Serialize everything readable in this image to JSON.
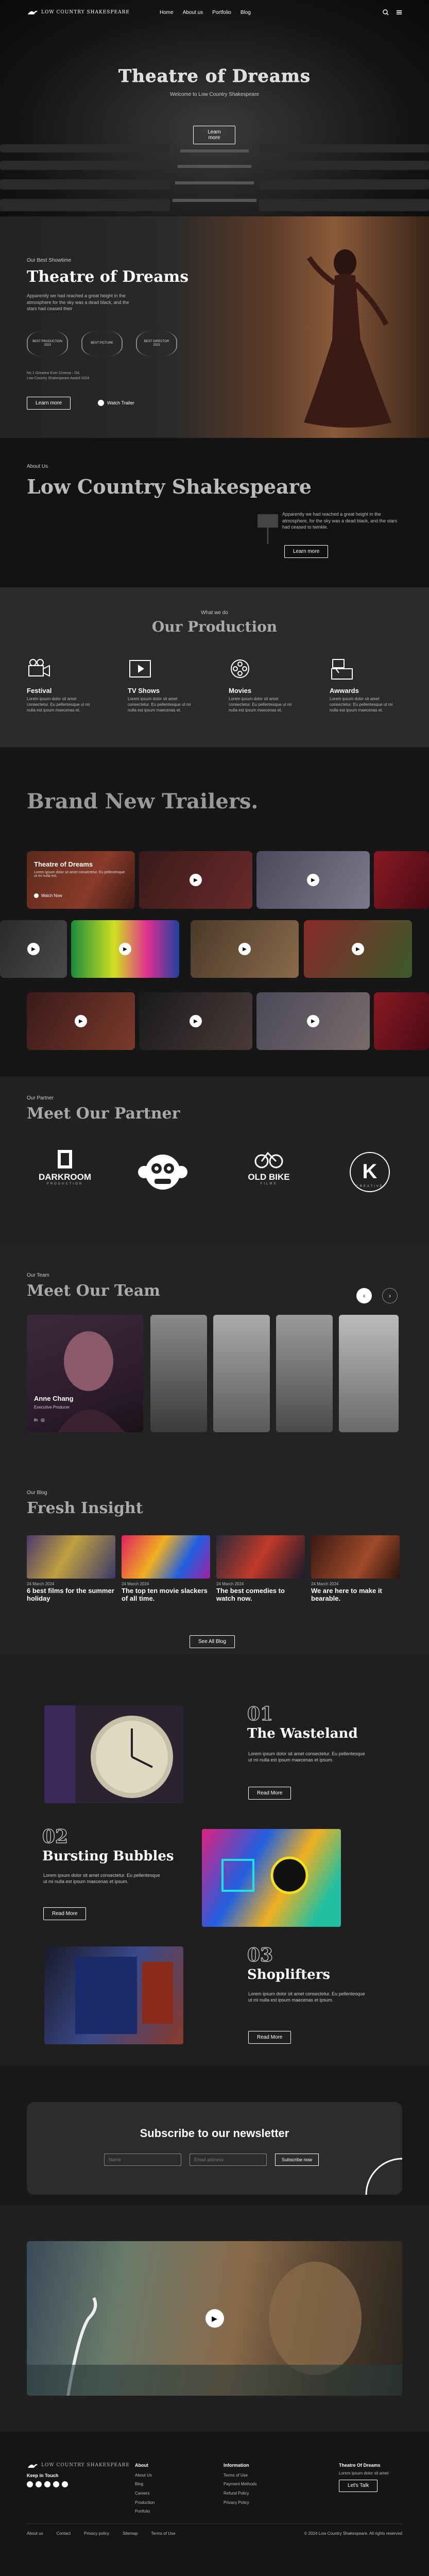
{
  "header": {
    "logo_text": "LOW COUNTRY SHAKESPEARE",
    "nav": [
      "Home",
      "About us",
      "Portfolio",
      "Blog"
    ],
    "icons": [
      "search-icon",
      "menu-icon"
    ]
  },
  "hero": {
    "title": "Theatre of Dreams",
    "subtitle": "Welcome to Low Country Shakespeare",
    "button": "Learn more"
  },
  "showtime": {
    "eyebrow": "Our Best Showtime",
    "title": "Theatre of Dreams",
    "description": "Apparently we had reached a great height in the atmosphere for the sky was a dead black, and the stars had ceased their",
    "badges": [
      "BEST PRODUCTION 2023",
      "BEST PICTURE",
      "BEST DIRECTOR 2023"
    ],
    "note_line1": "No 1 Greatest Ever Cinema - OA",
    "note_line2": "Low Country Shakespeare Award 2024",
    "learn_button": "Learn more",
    "watch_label": "Watch Trailer"
  },
  "about": {
    "eyebrow": "About Us",
    "title": "Low Country Shakespeare",
    "description": "Apparently we had reached a great height in the atmosphere, for the sky was a dead black, and the stars had ceased to twinkle.",
    "button": "Learn more"
  },
  "production": {
    "eyebrow": "What we do",
    "title": "Our Production",
    "items": [
      {
        "name": "Festival",
        "desc": "Lorem ipsum dolor sit amet consectetur. Eu pellentesque ut mi nulla est ipsum maecenas et.",
        "icon": "camera-icon"
      },
      {
        "name": "TV Shows",
        "desc": "Lorem ipsum dolor sit amet consectetur. Eu pellentesque ut mi nulla est ipsum maecenas et.",
        "icon": "film-strip-icon"
      },
      {
        "name": "Movies",
        "desc": "Lorem ipsum dolor sit amet consectetur. Eu pellentesque ut mi nulla est ipsum maecenas et.",
        "icon": "film-reel-icon"
      },
      {
        "name": "Awwards",
        "desc": "Lorem ipsum dolor sit amet consectetur. Eu pellentesque ut mi nulla est ipsum maecenas et.",
        "icon": "clapperboard-icon"
      }
    ]
  },
  "trailers": {
    "title": "Brand New Trailers.",
    "feature_title": "Theatre of Dreams",
    "feature_desc": "Lorem ipsum dolor sit amet consectetur. Eu pellentesque ut mi nulla est.",
    "feature_watch": "Watch Now"
  },
  "partners": {
    "eyebrow": "Our Partner",
    "title": "Meet Our Partner",
    "items": [
      {
        "name": "DARKROOM",
        "sub": "PRODUCTION"
      },
      {
        "name": "",
        "sub": ""
      },
      {
        "name": "OLD BIKE",
        "sub": "FILMS"
      },
      {
        "name": "K",
        "sub": "CREATIVE"
      }
    ]
  },
  "team": {
    "eyebrow": "Our Team",
    "title": "Meet Our Team",
    "featured_name": "Anne Chang",
    "featured_role": "Executive Producer",
    "arrows": [
      "arrow-left-icon",
      "arrow-right-icon"
    ]
  },
  "blog": {
    "eyebrow": "Our Blog",
    "title": "Fresh Insight",
    "posts": [
      {
        "date": "24 March 2024",
        "title": "6 best films for the summer holiday"
      },
      {
        "date": "24 March 2024",
        "title": "The top ten movie slackers of all time."
      },
      {
        "date": "24 March 2024",
        "title": "The best comedies to watch now."
      },
      {
        "date": "24 March 2024",
        "title": "We are here to make it bearable."
      }
    ],
    "see_all": "See All Blog"
  },
  "features": [
    {
      "num": "01",
      "title": "The Wasteland",
      "desc": "Lorem ipsum dolor sit amet consectetur. Eu pellentesque ut mi nulla est ipsum maecenas et ipsum.",
      "button": "Read More"
    },
    {
      "num": "02",
      "title": "Bursting Bubbles",
      "desc": "Lorem ipsum dolor sit amet consectetur. Eu pellentesque ut mi nulla est ipsum maecenas et ipsum.",
      "button": "Read More"
    },
    {
      "num": "03",
      "title": "Shoplifters",
      "desc": "Lorem ipsum dolor sit amet consectetur. Eu pellentesque ut mi nulla est ipsum maecenas et ipsum.",
      "button": "Read More"
    }
  ],
  "newsletter": {
    "title": "Subscribe to our newsletter",
    "name_placeholder": "Name",
    "email_placeholder": "Email address",
    "button": "Subscribe now"
  },
  "footer": {
    "logo_text": "LOW COUNTRY SHAKESPEARE",
    "keep_in_touch": "Keep in Touch",
    "social_icons": [
      "facebook-icon",
      "twitter-icon",
      "x-icon",
      "instagram-icon",
      "pinterest-icon"
    ],
    "about_heading": "About",
    "about_links": [
      "About Us",
      "Blog",
      "Careers",
      "Production",
      "Portfolio"
    ],
    "info_heading": "Information",
    "info_links": [
      "Terms of Use",
      "Payment Methods",
      "Refund Policy",
      "Privacy Policy"
    ],
    "cta_heading": "Theatre Of Dreams",
    "cta_desc": "Lorem ipsum dolor sit amet",
    "cta_button": "Let's Talk",
    "bottom_links": [
      "About us",
      "Contact",
      "Privacy policy",
      "Sitemap",
      "Terms of Use"
    ],
    "copyright": "© 2024 Low Country Shakespeare. All rights reserved"
  }
}
